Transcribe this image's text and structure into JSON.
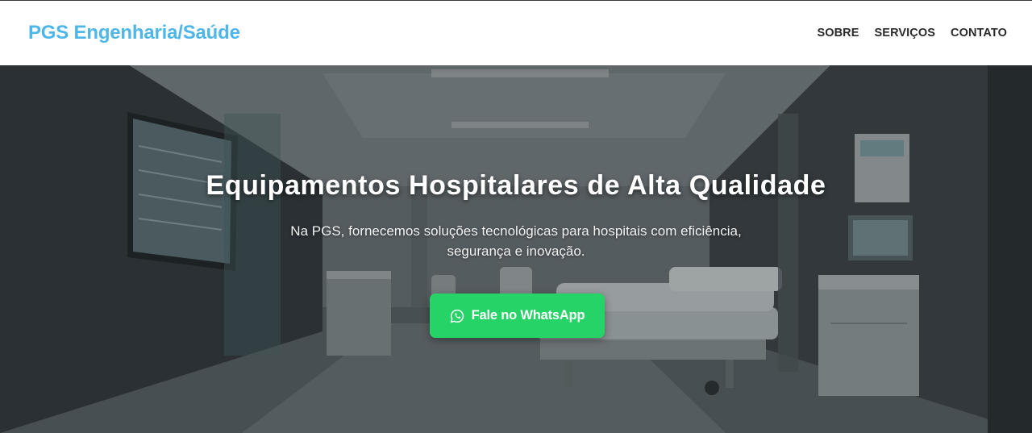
{
  "header": {
    "brand": "PGS Engenharia/Saúde",
    "nav": [
      {
        "label": "SOBRE"
      },
      {
        "label": "SERVIÇOS"
      },
      {
        "label": "CONTATO"
      }
    ]
  },
  "hero": {
    "title": "Equipamentos Hospitalares de Alta Qualidade",
    "subtitle": "Na PGS, fornecemos soluções tecnológicas para hospitais com eficiência, segurança e inovação.",
    "cta_label": "Fale no WhatsApp",
    "cta_icon": "whatsapp-icon"
  },
  "colors": {
    "brand": "#4fb6e9",
    "nav_text": "#2a2a2a",
    "cta_background": "#25d366",
    "header_background": "#ffffff"
  }
}
